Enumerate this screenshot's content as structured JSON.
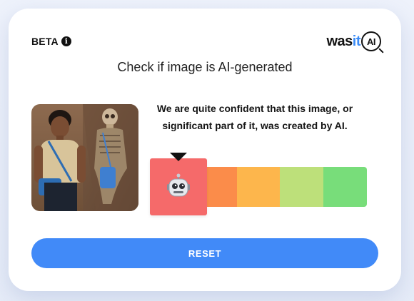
{
  "header": {
    "beta_label": "BETA",
    "info_icon": "info-icon",
    "logo": {
      "was": "was",
      "it": "it",
      "ai": "AI"
    }
  },
  "title": "Check if image is AI-generated",
  "result": {
    "verdict": "We are quite confident that this image, or significant part of it, was created by AI.",
    "meter_segments": 5,
    "active_segment": 1,
    "active_icon": "robot-icon",
    "colors": {
      "segment_1": "#f56a6a",
      "segment_2": "#fb8c4a",
      "segment_3": "#fdb64c",
      "segment_4": "#bde07a",
      "segment_5": "#78dd7a"
    }
  },
  "actions": {
    "reset_label": "RESET"
  },
  "colors": {
    "accent": "#418af8",
    "logo_it": "#3b8cf7"
  }
}
